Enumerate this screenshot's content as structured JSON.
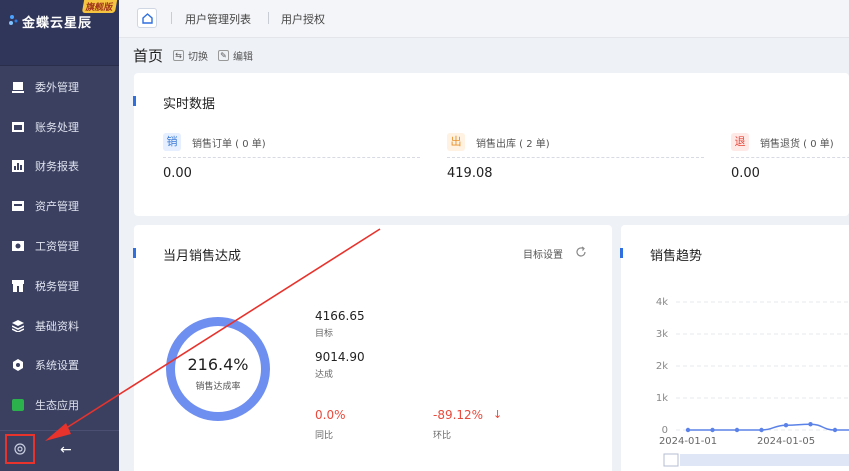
{
  "brand": {
    "name": "金蝶云星辰",
    "edition": "旗舰版"
  },
  "sidebar": {
    "items": [
      {
        "label": "委外管理",
        "icon": "outsource-icon"
      },
      {
        "label": "账务处理",
        "icon": "accounting-icon"
      },
      {
        "label": "财务报表",
        "icon": "report-icon"
      },
      {
        "label": "资产管理",
        "icon": "asset-icon"
      },
      {
        "label": "工资管理",
        "icon": "salary-icon"
      },
      {
        "label": "税务管理",
        "icon": "tax-icon"
      },
      {
        "label": "基础资料",
        "icon": "layers-icon"
      },
      {
        "label": "系统设置",
        "icon": "settings-icon"
      },
      {
        "label": "生态应用",
        "icon": "ecosystem-icon"
      }
    ]
  },
  "topbar": {
    "tabs": [
      "用户管理列表",
      "用户授权"
    ]
  },
  "page": {
    "title": "首页",
    "switch_label": "切换",
    "edit_label": "编辑"
  },
  "realtime": {
    "title": "实时数据",
    "stats": [
      {
        "badge": "销",
        "label": "销售订单 ( 0 单)",
        "value": "0.00",
        "badge_color": "#3a7bd5",
        "badge_bg": "#e6efff"
      },
      {
        "badge": "出",
        "label": "销售出库 ( 2 单)",
        "value": "419.08",
        "badge_color": "#e8902b",
        "badge_bg": "#fff2e2"
      },
      {
        "badge": "退",
        "label": "销售退货 ( 0 单)",
        "value": "0.00",
        "badge_color": "#e84a3c",
        "badge_bg": "#ffe9e7"
      }
    ]
  },
  "achievement": {
    "title": "当月销售达成",
    "target_setting": "目标设置",
    "rate": "216.4%",
    "rate_label": "销售达成率",
    "target_value": "4166.65",
    "target_label": "目标",
    "achieved_value": "9014.90",
    "achieved_label": "达成",
    "yoy_value": "0.0%",
    "yoy_label": "同比",
    "mom_value": "-89.12%",
    "mom_label": "环比",
    "mom_arrow": "↓"
  },
  "trend": {
    "title": "销售趋势"
  },
  "chart_data": {
    "type": "line",
    "y_ticks": [
      "4k",
      "3k",
      "2k",
      "1k",
      "0"
    ],
    "ylim": [
      0,
      4000
    ],
    "x_tick_labels": [
      "2024-01-01",
      "2024-01-05"
    ],
    "series": [
      {
        "values": [
          0,
          0,
          0,
          0,
          150,
          180,
          0,
          0,
          0,
          0
        ]
      }
    ]
  },
  "colors": {
    "accent": "#2f6fe0",
    "donut": "#6e8ef0",
    "negative": "#e84a3c"
  }
}
